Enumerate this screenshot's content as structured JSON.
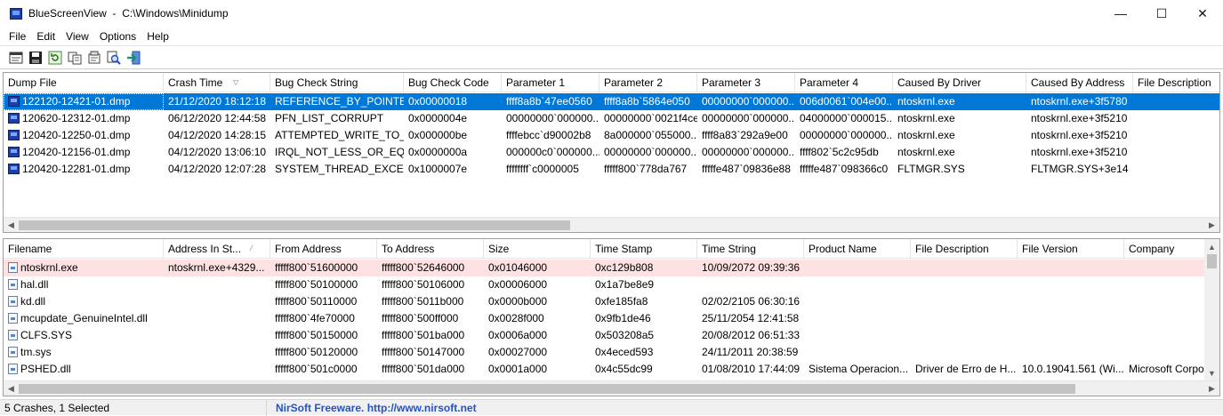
{
  "window": {
    "app_name": "BlueScreenView",
    "separator": "-",
    "path": "C:\\Windows\\Minidump",
    "minimize": "—",
    "maximize": "☐",
    "close": "✕"
  },
  "menu": [
    "File",
    "Edit",
    "View",
    "Options",
    "Help"
  ],
  "toolbar": [
    "html-report-icon",
    "save-icon",
    "refresh-icon",
    "copy-icon",
    "properties-icon",
    "search-icon",
    "exit-icon"
  ],
  "top_list": {
    "sort_indicator": "▽",
    "columns": [
      "Dump File",
      "Crash Time",
      "Bug Check String",
      "Bug Check Code",
      "Parameter 1",
      "Parameter 2",
      "Parameter 3",
      "Parameter 4",
      "Caused By Driver",
      "Caused By Address",
      "File Description"
    ],
    "rows": [
      [
        "122120-12421-01.dmp",
        "21/12/2020 18:12:18",
        "REFERENCE_BY_POINTER",
        "0x00000018",
        "ffff8a8b`47ee0560",
        "ffff8a8b`5864e050",
        "00000000`000000...",
        "006d0061`004e00...",
        "ntoskrnl.exe",
        "ntoskrnl.exe+3f5780",
        ""
      ],
      [
        "120620-12312-01.dmp",
        "06/12/2020 12:44:58",
        "PFN_LIST_CORRUPT",
        "0x0000004e",
        "00000000`000000...",
        "00000000`0021f4ce",
        "00000000`000000...",
        "04000000`000015...",
        "ntoskrnl.exe",
        "ntoskrnl.exe+3f5210",
        ""
      ],
      [
        "120420-12250-01.dmp",
        "04/12/2020 14:28:15",
        "ATTEMPTED_WRITE_TO_...",
        "0x000000be",
        "ffffebcc`d90002b8",
        "8a000000`055000...",
        "ffff8a83`292a9e00",
        "00000000`000000...",
        "ntoskrnl.exe",
        "ntoskrnl.exe+3f5210",
        ""
      ],
      [
        "120420-12156-01.dmp",
        "04/12/2020 13:06:10",
        "IRQL_NOT_LESS_OR_EQ...",
        "0x0000000a",
        "000000c0`000000...",
        "00000000`000000...",
        "00000000`000000...",
        "ffff802`5c2c95db",
        "ntoskrnl.exe",
        "ntoskrnl.exe+3f5210",
        ""
      ],
      [
        "120420-12281-01.dmp",
        "04/12/2020 12:07:28",
        "SYSTEM_THREAD_EXCE...",
        "0x1000007e",
        "ffffffff`c0000005",
        "fffff800`778da767",
        "fffffe487`09836e88",
        "fffffe487`098366c0",
        "FLTMGR.SYS",
        "FLTMGR.SYS+3e14",
        ""
      ]
    ]
  },
  "bottom_list": {
    "sort_indicator": "⁄",
    "columns": [
      "Filename",
      "Address In St...",
      "From Address",
      "To Address",
      "Size",
      "Time Stamp",
      "Time String",
      "Product Name",
      "File Description",
      "File Version",
      "Company"
    ],
    "rows": [
      [
        "ntoskrnl.exe",
        "ntoskrnl.exe+4329...",
        "fffff800`51600000",
        "fffff800`52646000",
        "0x01046000",
        "0xc129b808",
        "10/09/2072 09:39:36",
        "",
        "",
        "",
        ""
      ],
      [
        "hal.dll",
        "",
        "fffff800`50100000",
        "fffff800`50106000",
        "0x00006000",
        "0x1a7be8e9",
        "",
        "",
        "",
        "",
        ""
      ],
      [
        "kd.dll",
        "",
        "fffff800`50110000",
        "fffff800`5011b000",
        "0x0000b000",
        "0xfe185fa8",
        "02/02/2105 06:30:16",
        "",
        "",
        "",
        ""
      ],
      [
        "mcupdate_GenuineIntel.dll",
        "",
        "fffff800`4fe70000",
        "fffff800`500ff000",
        "0x0028f000",
        "0x9fb1de46",
        "25/11/2054 12:41:58",
        "",
        "",
        "",
        ""
      ],
      [
        "CLFS.SYS",
        "",
        "fffff800`50150000",
        "fffff800`501ba000",
        "0x0006a000",
        "0x503208a5",
        "20/08/2012 06:51:33",
        "",
        "",
        "",
        ""
      ],
      [
        "tm.sys",
        "",
        "fffff800`50120000",
        "fffff800`50147000",
        "0x00027000",
        "0x4eced593",
        "24/11/2011 20:38:59",
        "",
        "",
        "",
        ""
      ],
      [
        "PSHED.dll",
        "",
        "fffff800`501c0000",
        "fffff800`501da000",
        "0x0001a000",
        "0x4c55dc99",
        "01/08/2010 17:44:09",
        "Sistema Operacion...",
        "Driver de Erro de H...",
        "10.0.19041.561 (Wi...",
        "Microsoft Corpo"
      ]
    ]
  },
  "status": {
    "summary": "5 Crashes, 1 Selected",
    "link": "NirSoft Freeware.  http://www.nirsoft.net"
  },
  "colors": {
    "selected_row": "#0078d7",
    "flagged_row": "#fde1e3",
    "link": "#2452c7"
  }
}
